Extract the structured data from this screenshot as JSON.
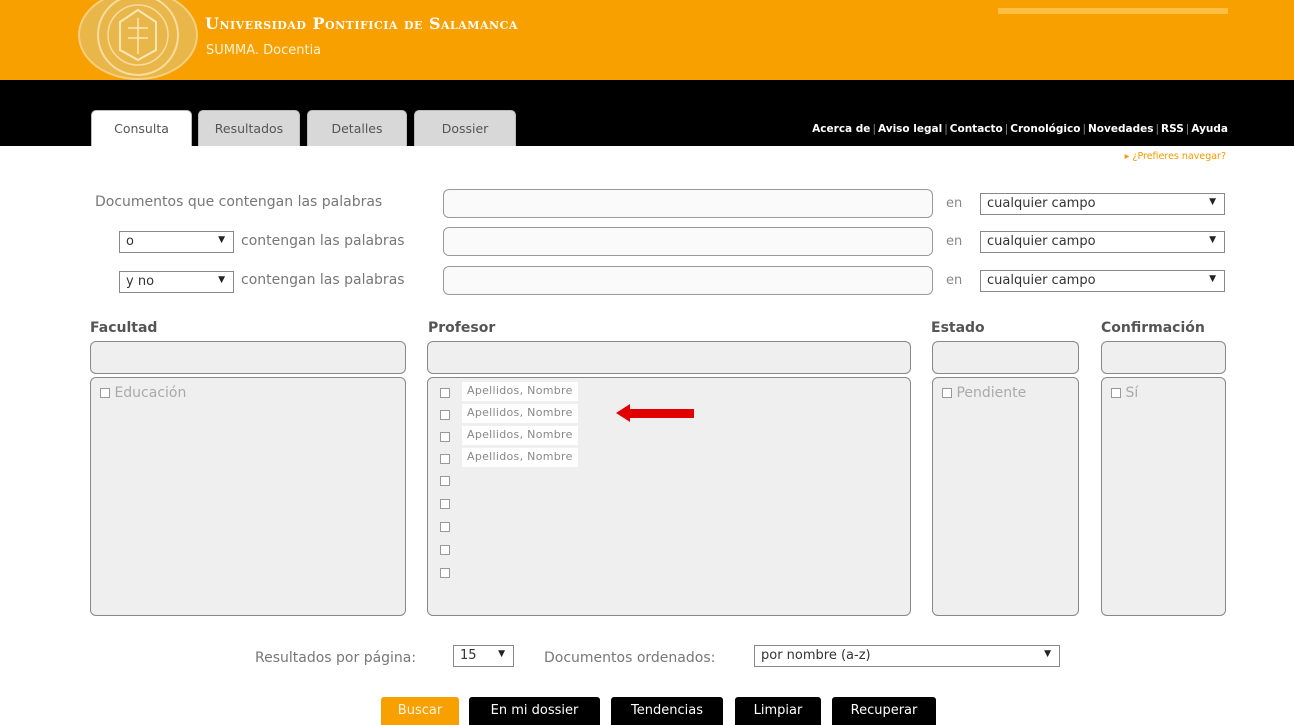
{
  "header": {
    "university": "Universidad Pontificia de Salamanca",
    "app": "SUMMA. Docentia"
  },
  "tabs": [
    "Consulta",
    "Resultados",
    "Detalles",
    "Dossier"
  ],
  "top_links": [
    "Acerca de",
    "Aviso legal",
    "Contacto",
    "Cronológico",
    "Novedades",
    "RSS",
    "Ayuda"
  ],
  "browse_link": "▸ ¿Prefieres navegar?",
  "search": {
    "row1_label": "Documentos que contengan las palabras",
    "row_label": "contengan las palabras",
    "en": "en",
    "operator1": "o",
    "operator2": "y no",
    "field": "cualquier campo"
  },
  "filters": {
    "facultad": {
      "title": "Facultad",
      "options": [
        "Educación"
      ]
    },
    "profesor": {
      "title": "Profesor",
      "options": [
        "Apellidos, Nombre",
        "Apellidos, Nombre",
        "Apellidos, Nombre",
        "Apellidos, Nombre"
      ]
    },
    "estado": {
      "title": "Estado",
      "options": [
        "Pendiente"
      ]
    },
    "confirmacion": {
      "title": "Confirmación",
      "options": [
        "Sí"
      ]
    }
  },
  "pagination": {
    "per_page_label": "Resultados por página:",
    "per_page_value": "15",
    "order_label": "Documentos ordenados:",
    "order_value": "por nombre (a-z)"
  },
  "buttons": [
    "Buscar",
    "En mi dossier",
    "Tendencias",
    "Limpiar",
    "Recuperar"
  ],
  "colors": {
    "accent": "#f7a000",
    "bar": "#000000",
    "arrow": "#e00000"
  }
}
